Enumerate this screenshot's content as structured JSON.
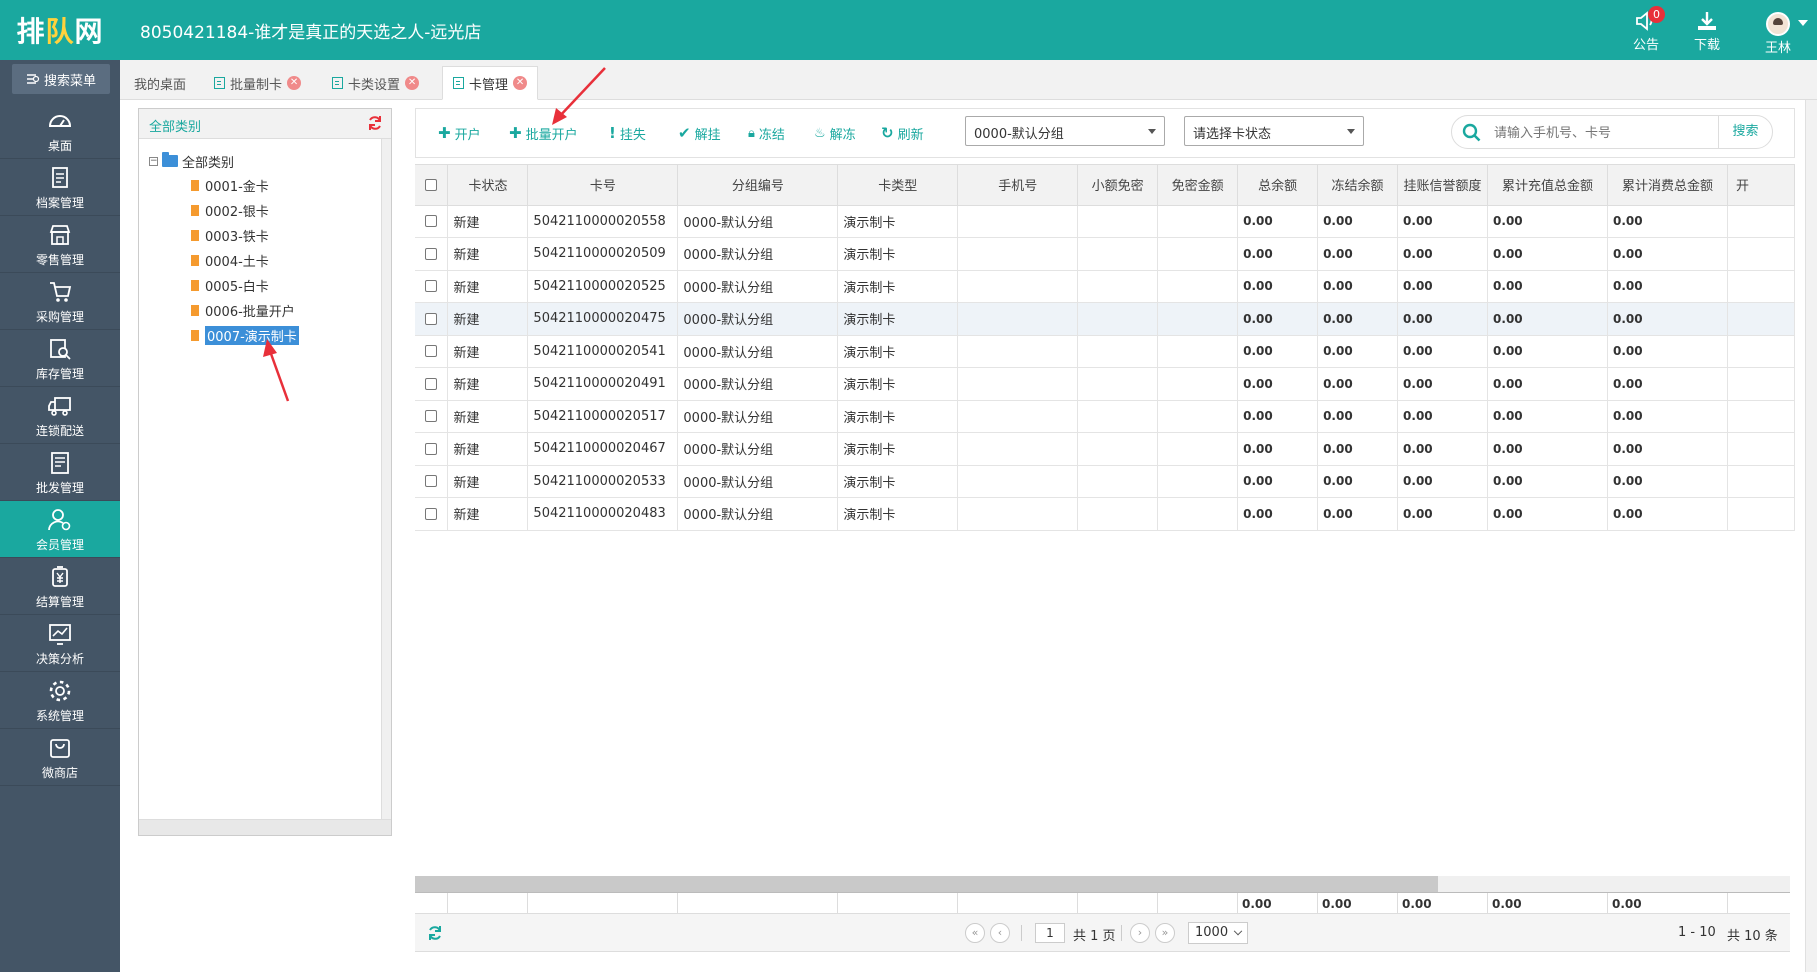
{
  "header": {
    "logo": {
      "part1": "排",
      "part2": "队",
      "part3": "网"
    },
    "store_title": "8050421184-谁才是真正的天选之人-远光店",
    "announcement_label": "公告",
    "announcement_badge": "0",
    "download_label": "下载",
    "user_name": "王林"
  },
  "sidebar": {
    "search_menu_label": "搜索菜单",
    "items": [
      {
        "label": "桌面",
        "icon": "dashboard-icon"
      },
      {
        "label": "档案管理",
        "icon": "archive-icon"
      },
      {
        "label": "零售管理",
        "icon": "store-icon"
      },
      {
        "label": "采购管理",
        "icon": "cart-icon"
      },
      {
        "label": "库存管理",
        "icon": "inventory-icon"
      },
      {
        "label": "连锁配送",
        "icon": "truck-icon"
      },
      {
        "label": "批发管理",
        "icon": "wholesale-icon"
      },
      {
        "label": "会员管理",
        "icon": "member-icon",
        "active": true
      },
      {
        "label": "结算管理",
        "icon": "yen-icon"
      },
      {
        "label": "决策分析",
        "icon": "chart-icon"
      },
      {
        "label": "系统管理",
        "icon": "gear-icon"
      },
      {
        "label": "微商店",
        "icon": "bag-icon"
      }
    ]
  },
  "tabs": [
    {
      "label": "我的桌面"
    },
    {
      "label": "批量制卡"
    },
    {
      "label": "卡类设置"
    },
    {
      "label": "卡管理",
      "active": true
    }
  ],
  "tree": {
    "header": "全部类别",
    "root": "全部类别",
    "nodes": [
      "0001-金卡",
      "0002-银卡",
      "0003-铁卡",
      "0004-土卡",
      "0005-白卡",
      "0006-批量开户",
      "0007-演示制卡"
    ],
    "selected": "0007-演示制卡"
  },
  "toolbar": {
    "open_account": "开户",
    "batch_open": "批量开户",
    "report_loss": "挂失",
    "cancel_loss": "解挂",
    "freeze": "冻结",
    "unfreeze": "解冻",
    "refresh": "刷新",
    "group_select": "0000-默认分组",
    "status_select": "请选择卡状态",
    "search_placeholder": "请输入手机号、卡号",
    "search_button": "搜索"
  },
  "table": {
    "columns": [
      "卡状态",
      "卡号",
      "分组编号",
      "卡类型",
      "手机号",
      "小额免密",
      "免密金额",
      "总余额",
      "冻结余额",
      "挂账信誉额度",
      "累计充值总金额",
      "累计消费总金额",
      "开"
    ],
    "rows": [
      [
        "新建",
        "5042110000020558",
        "0000-默认分组",
        "演示制卡",
        "",
        "",
        "",
        "0.00",
        "0.00",
        "0.00",
        "0.00",
        "0.00"
      ],
      [
        "新建",
        "5042110000020509",
        "0000-默认分组",
        "演示制卡",
        "",
        "",
        "",
        "0.00",
        "0.00",
        "0.00",
        "0.00",
        "0.00"
      ],
      [
        "新建",
        "5042110000020525",
        "0000-默认分组",
        "演示制卡",
        "",
        "",
        "",
        "0.00",
        "0.00",
        "0.00",
        "0.00",
        "0.00"
      ],
      [
        "新建",
        "5042110000020475",
        "0000-默认分组",
        "演示制卡",
        "",
        "",
        "",
        "0.00",
        "0.00",
        "0.00",
        "0.00",
        "0.00"
      ],
      [
        "新建",
        "5042110000020541",
        "0000-默认分组",
        "演示制卡",
        "",
        "",
        "",
        "0.00",
        "0.00",
        "0.00",
        "0.00",
        "0.00"
      ],
      [
        "新建",
        "5042110000020491",
        "0000-默认分组",
        "演示制卡",
        "",
        "",
        "",
        "0.00",
        "0.00",
        "0.00",
        "0.00",
        "0.00"
      ],
      [
        "新建",
        "5042110000020517",
        "0000-默认分组",
        "演示制卡",
        "",
        "",
        "",
        "0.00",
        "0.00",
        "0.00",
        "0.00",
        "0.00"
      ],
      [
        "新建",
        "5042110000020467",
        "0000-默认分组",
        "演示制卡",
        "",
        "",
        "",
        "0.00",
        "0.00",
        "0.00",
        "0.00",
        "0.00"
      ],
      [
        "新建",
        "5042110000020533",
        "0000-默认分组",
        "演示制卡",
        "",
        "",
        "",
        "0.00",
        "0.00",
        "0.00",
        "0.00",
        "0.00"
      ],
      [
        "新建",
        "5042110000020483",
        "0000-默认分组",
        "演示制卡",
        "",
        "",
        "",
        "0.00",
        "0.00",
        "0.00",
        "0.00",
        "0.00"
      ]
    ],
    "highlighted_row": 3,
    "footer_totals": [
      "0.00",
      "0.00",
      "0.00",
      "0.00",
      "0.00"
    ]
  },
  "pager": {
    "current_page": "1",
    "total_pages_text": "共 1 页",
    "page_size": "1000",
    "range_text": "1 - 10",
    "total_text": "共 10 条"
  },
  "colors": {
    "primary": "#1aa89f",
    "sidebar": "#445566",
    "annotation_arrow": "#e8303a"
  }
}
